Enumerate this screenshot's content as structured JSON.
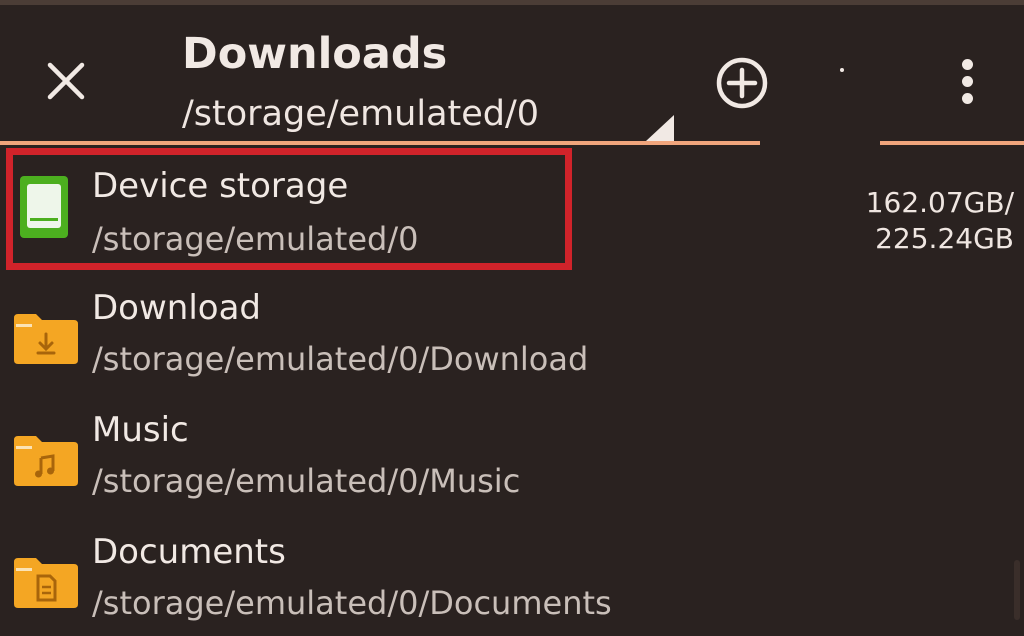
{
  "header": {
    "title": "Downloads",
    "path": "/storage/emulated/0",
    "close_icon": "close-icon",
    "add_icon": "add-circle-icon",
    "more_icon": "more-vert-icon"
  },
  "storage": {
    "used": "162.07GB/",
    "total": "225.24GB"
  },
  "items": [
    {
      "name": "Device storage",
      "path": "/storage/emulated/0",
      "icon": "device-storage-icon"
    },
    {
      "name": "Download",
      "path": "/storage/emulated/0/Download",
      "icon": "download-folder-icon"
    },
    {
      "name": "Music",
      "path": "/storage/emulated/0/Music",
      "icon": "music-folder-icon"
    },
    {
      "name": "Documents",
      "path": "/storage/emulated/0/Documents",
      "icon": "documents-folder-icon"
    }
  ],
  "colors": {
    "background": "#2a2220",
    "accent": "#f0a57c",
    "highlight": "#d0232a",
    "storage_green": "#4caf1f",
    "folder_orange": "#f4a623"
  }
}
